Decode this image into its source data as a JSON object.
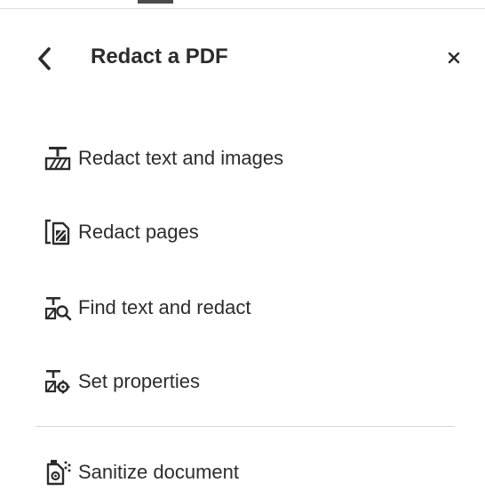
{
  "panel": {
    "title": "Redact a PDF",
    "back_icon": "chevron-left-icon",
    "close_icon": "close-icon"
  },
  "menu": {
    "items": [
      {
        "label": "Redact text and images",
        "icon": "redact-text-images-icon"
      },
      {
        "label": "Redact pages",
        "icon": "redact-pages-icon"
      },
      {
        "label": "Find text and redact",
        "icon": "find-text-redact-icon"
      },
      {
        "label": "Set properties",
        "icon": "set-properties-icon"
      }
    ],
    "secondary": [
      {
        "label": "Sanitize document",
        "icon": "sanitize-document-icon"
      }
    ]
  }
}
